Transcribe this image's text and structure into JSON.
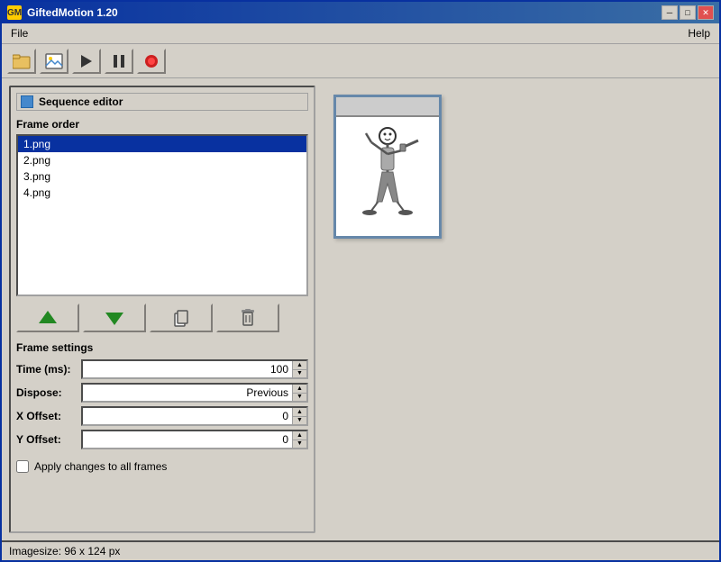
{
  "window": {
    "title": "GiftedMotion 1.20",
    "icon": "GM"
  },
  "titlebar_buttons": {
    "minimize": "─",
    "maximize": "□",
    "close": "✕"
  },
  "menubar": {
    "file": "File",
    "help": "Help"
  },
  "toolbar": {
    "open_icon": "📂",
    "image_icon": "🖼",
    "play_icon": "▶",
    "pause_icon": "⏸",
    "record_icon": "⏺"
  },
  "sequence_editor": {
    "title": "Sequence editor",
    "frame_order_label": "Frame order",
    "frames": [
      {
        "name": "1.png",
        "selected": true
      },
      {
        "name": "2.png",
        "selected": false
      },
      {
        "name": "3.png",
        "selected": false
      },
      {
        "name": "4.png",
        "selected": false
      }
    ]
  },
  "action_buttons": {
    "up": "▲",
    "down": "▼",
    "copy": "⎘",
    "delete": "🗑"
  },
  "frame_settings": {
    "title": "Frame settings",
    "time_label": "Time (ms):",
    "time_value": "100",
    "dispose_label": "Dispose:",
    "dispose_value": "Previous",
    "x_offset_label": "X Offset:",
    "x_offset_value": "0",
    "y_offset_label": "Y Offset:",
    "y_offset_value": "0",
    "apply_label": "Apply changes to all frames"
  },
  "statusbar": {
    "text": "Imagesize: 96 x 124 px"
  },
  "colors": {
    "accent": "#0831a0",
    "green": "#228822",
    "panel_bg": "#d4d0c8",
    "list_bg": "#ffffff"
  }
}
